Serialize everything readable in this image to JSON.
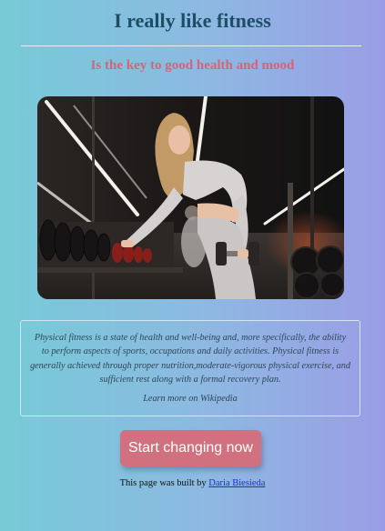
{
  "header": {
    "title": "I really like fitness",
    "subtitle": "Is the key to good health and mood"
  },
  "hero_image": {
    "alt": "Woman lifting dumbbells from a rack in a gym"
  },
  "info": {
    "description": "Physical fitness is a state of health and well-being and, more specifically, the ability to perform aspects of sports, occupations and daily activities. Physical fitness is generally achieved through proper nutrition,moderate-vigorous physical exercise, and sufficient rest along with a formal recovery plan.",
    "learn_more": "Learn more on Wikipedia"
  },
  "cta": {
    "label": "Start changing now"
  },
  "footer": {
    "prefix": "This page was built by",
    "author": "Daria Biesieda"
  },
  "colors": {
    "title": "#1d4e66",
    "subtitle": "#d7637a",
    "button": "#d1707f",
    "link": "#1a2fd6"
  }
}
